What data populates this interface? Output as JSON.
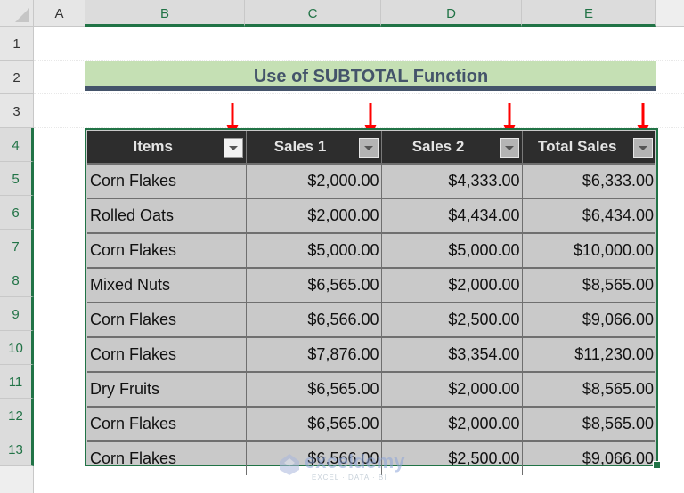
{
  "sheet": {
    "columns": [
      "A",
      "B",
      "C",
      "D",
      "E"
    ],
    "selected_columns": [
      "B",
      "C",
      "D",
      "E"
    ],
    "rows": [
      "1",
      "2",
      "3",
      "4",
      "5",
      "6",
      "7",
      "8",
      "9",
      "10",
      "11",
      "12",
      "13"
    ],
    "selected_rows": [
      "4",
      "5",
      "6",
      "7",
      "8",
      "9",
      "10",
      "11",
      "12",
      "13"
    ]
  },
  "title": "Use of SUBTOTAL Function",
  "table": {
    "headers": [
      "Items",
      "Sales 1",
      "Sales 2",
      "Total Sales"
    ],
    "rows": [
      [
        "Corn Flakes",
        "$2,000.00",
        "$4,333.00",
        "$6,333.00"
      ],
      [
        "Rolled Oats",
        "$2,000.00",
        "$4,434.00",
        "$6,434.00"
      ],
      [
        "Corn Flakes",
        "$5,000.00",
        "$5,000.00",
        "$10,000.00"
      ],
      [
        "Mixed Nuts",
        "$6,565.00",
        "$2,000.00",
        "$8,565.00"
      ],
      [
        "Corn Flakes",
        "$6,566.00",
        "$2,500.00",
        "$9,066.00"
      ],
      [
        "Corn Flakes",
        "$7,876.00",
        "$3,354.00",
        "$11,230.00"
      ],
      [
        "Dry Fruits",
        "$6,565.00",
        "$2,000.00",
        "$8,565.00"
      ],
      [
        "Corn Flakes",
        "$6,565.00",
        "$2,000.00",
        "$8,565.00"
      ],
      [
        "Corn Flakes",
        "$6,566.00",
        "$2,500.00",
        "$9,066.00"
      ]
    ]
  },
  "annotations": {
    "arrow_color": "#ff0000",
    "arrow_targets": [
      "Items filter",
      "Sales 1 filter",
      "Sales 2 filter",
      "Total Sales filter"
    ]
  },
  "watermark": {
    "name": "exceldemy",
    "tagline": "EXCEL · DATA · BI"
  },
  "colors": {
    "accent": "#217346",
    "title_bg": "#c5e0b4",
    "title_text": "#44546a",
    "header_bg": "#2d2d2d",
    "cell_bg": "#c9c9c9"
  }
}
